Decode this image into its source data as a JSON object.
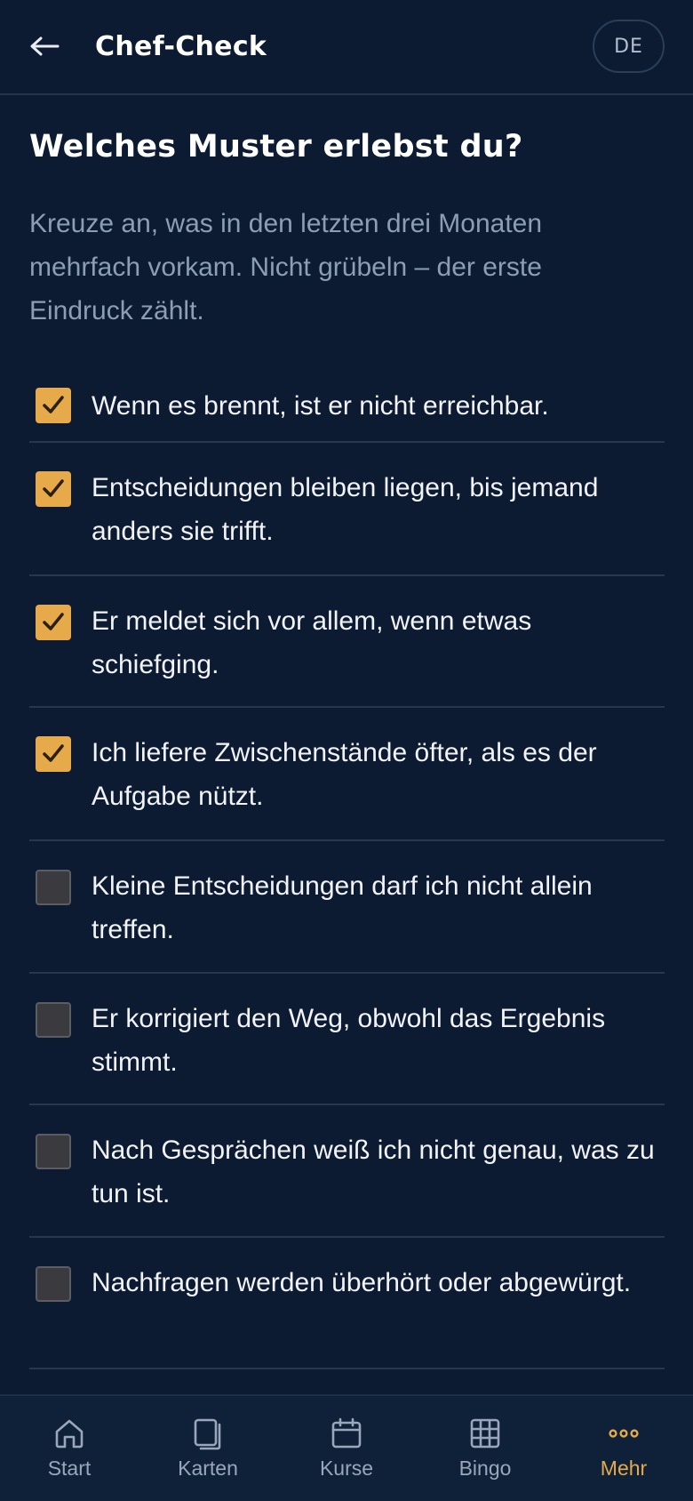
{
  "header": {
    "title": "Chef-Check",
    "lang": "DE"
  },
  "main": {
    "heading": "Welches Muster erlebst du?",
    "intro": "Kreuze an, was in den letzten drei Monaten mehrfach vorkam. Nicht grübeln – der erste Eindruck zählt.",
    "items": [
      {
        "label": "Wenn es brennt, ist er nicht erreichbar.",
        "checked": true
      },
      {
        "label": "Entscheidungen bleiben liegen, bis jemand anders sie trifft.",
        "checked": true
      },
      {
        "label": "Er meldet sich vor allem, wenn etwas schiefging.",
        "checked": true
      },
      {
        "label": "Ich liefere Zwischenstände öfter, als es der Aufgabe nützt.",
        "checked": true
      },
      {
        "label": "Kleine Entscheidungen darf ich nicht allein treffen.",
        "checked": false
      },
      {
        "label": "Er korrigiert den Weg, obwohl das Ergebnis stimmt.",
        "checked": false
      },
      {
        "label": "Nach Gesprächen weiß ich nicht genau, was zu tun ist.",
        "checked": false
      },
      {
        "label": "Nachfragen werden überhört oder abgewürgt.",
        "checked": false
      }
    ]
  },
  "nav": {
    "items": [
      {
        "label": "Start",
        "icon": "home-icon",
        "active": false
      },
      {
        "label": "Karten",
        "icon": "cards-icon",
        "active": false
      },
      {
        "label": "Kurse",
        "icon": "calendar-icon",
        "active": false
      },
      {
        "label": "Bingo",
        "icon": "grid-icon",
        "active": false
      },
      {
        "label": "Mehr",
        "icon": "more-icon",
        "active": true
      }
    ]
  },
  "colors": {
    "background": "#0c1b31",
    "accent": "#e7aa4a",
    "muted_text": "#8d9db3",
    "divider": "#26374f",
    "nav_background": "#0f2039"
  }
}
